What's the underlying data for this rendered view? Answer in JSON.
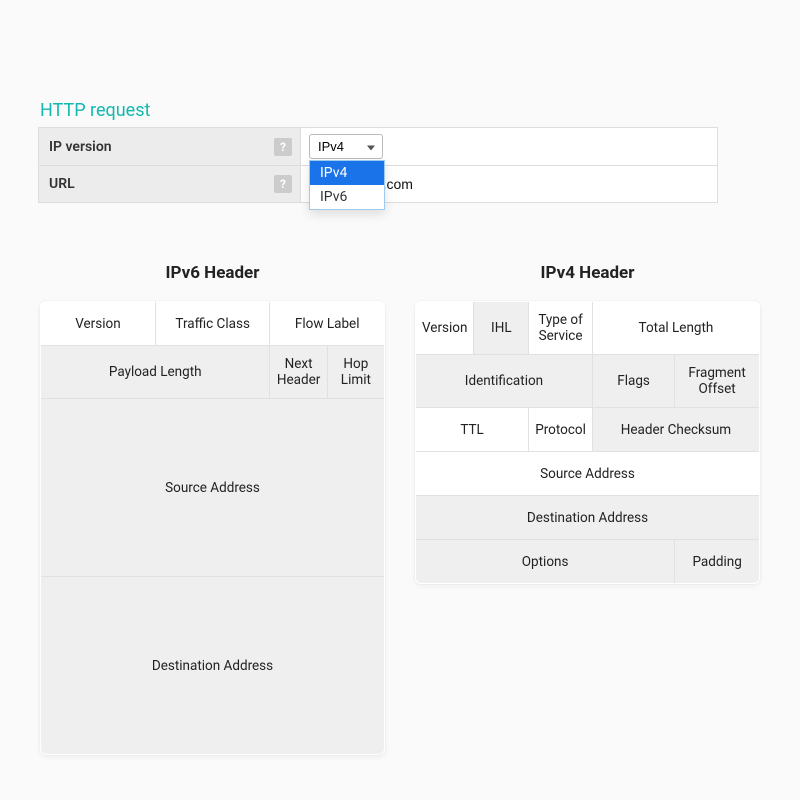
{
  "panel": {
    "title": "HTTP request"
  },
  "form": {
    "ip_version": {
      "label": "IP version",
      "selected": "IPv4",
      "options": [
        "IPv4",
        "IPv6"
      ]
    },
    "url": {
      "label": "URL",
      "value": "acticresorts.com"
    },
    "help_glyph": "?"
  },
  "ipv6": {
    "title": "IPv6 Header",
    "row1": {
      "version": "Version",
      "traffic_class": "Traffic Class",
      "flow_label": "Flow Label"
    },
    "row2": {
      "payload_length": "Payload Length",
      "next_header": "Next Header",
      "hop_limit": "Hop Limit"
    },
    "src": "Source Address",
    "dst": "Destination Address"
  },
  "ipv4": {
    "title": "IPv4 Header",
    "row1": {
      "version": "Version",
      "ihl": "IHL",
      "tos": "Type of Service",
      "total_length": "Total Length"
    },
    "row2": {
      "identification": "Identification",
      "flags": "Flags",
      "frag_offset": "Fragment Offset"
    },
    "row3": {
      "ttl": "TTL",
      "protocol": "Protocol",
      "checksum": "Header Checksum"
    },
    "src": "Source Address",
    "dst": "Destination Address",
    "options": "Options",
    "padding": "Padding"
  }
}
